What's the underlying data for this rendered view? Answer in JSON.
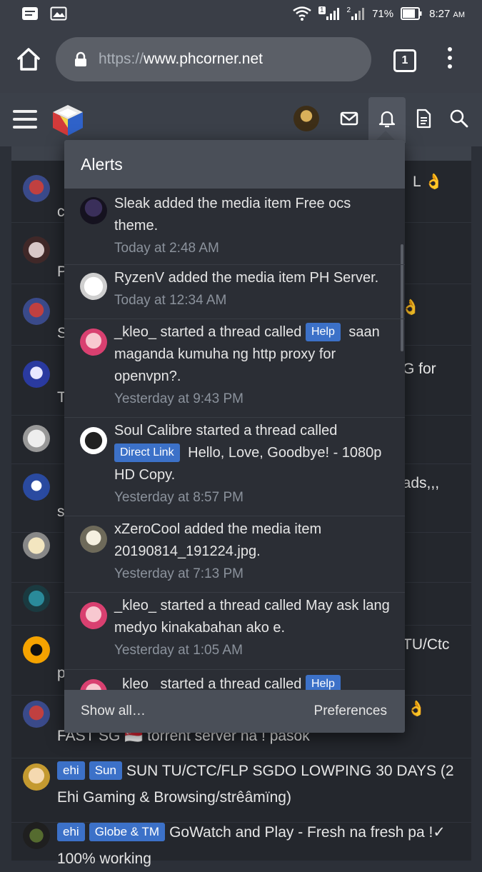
{
  "status_bar": {
    "battery_percent": "71%",
    "time": "8:27",
    "am_pm": "AM",
    "sim1_label": "1",
    "sim2_label": "2"
  },
  "browser": {
    "url_scheme": "https://",
    "url_host": "www.phcorner.net",
    "tab_count": "1"
  },
  "alerts": {
    "title": "Alerts",
    "items": [
      {
        "parts": [
          "Sleak added the media item Free ocs theme."
        ],
        "time": "Today at 2:48 AM"
      },
      {
        "parts": [
          "RyzenV added the media item PH Server."
        ],
        "time": "Today at 12:34 AM"
      },
      {
        "prefix": "_kleo_ started a thread called ",
        "tag": "Help",
        "suffix": " saan maganda kumuha ng http proxy for openvpn?.",
        "time": "Yesterday at 9:43 PM"
      },
      {
        "prefix": "Soul Calibre started a thread called ",
        "tag": "Direct Link",
        "suffix": " Hello, Love, Goodbye! - 1080p HD Copy.",
        "time": "Yesterday at 8:57 PM"
      },
      {
        "parts": [
          "xZeroCool added the media item 20190814_191224.jpg."
        ],
        "time": "Yesterday at 7:13 PM"
      },
      {
        "parts": [
          "_kleo_ started a thread called May ask lang medyo kinakabahan ako e."
        ],
        "time": "Yesterday at 1:05 AM"
      },
      {
        "prefix": "_kleo_ started a thread called ",
        "tag": "Help",
        "suffix": "",
        "time": ""
      }
    ],
    "show_all": "Show all…",
    "preferences": "Preferences"
  },
  "threads": {
    "visible_fragments": [
      {
        "right_text": "L 👌",
        "left_text": "c"
      },
      {
        "right_text": "",
        "left_text": "P"
      },
      {
        "right_text": "👌",
        "left_text": "S"
      },
      {
        "right_text": "G for",
        "left_text": "T"
      },
      {
        "right_text": "",
        "left_text": ""
      },
      {
        "right_text": "oads,,,",
        "left_text": "s"
      },
      {
        "right_text": "",
        "left_text": ""
      },
      {
        "right_text": "",
        "left_text": ""
      },
      {
        "right_text": "TU/Ctc",
        "left_text": "p"
      },
      {
        "right_text": "👌",
        "left_text": "FAST SG 🇸🇬 torrent server na ! pasok"
      }
    ],
    "full_items": [
      {
        "tags": [
          "ehi",
          "Sun"
        ],
        "title": "SUN TU/CTC/FLP SGDO LOWPING 30 DAYS (2 Ehi Gaming & Browsing/strêâmïng)"
      },
      {
        "tags": [
          "ehi",
          "Globe & TM"
        ],
        "title": "GoWatch and Play - Fresh na fresh pa !✓ 100% working"
      }
    ]
  },
  "colors": {
    "accent_tag": "#3c71c8",
    "header_bg": "#3b4049",
    "popup_bg": "#2b2e35"
  }
}
